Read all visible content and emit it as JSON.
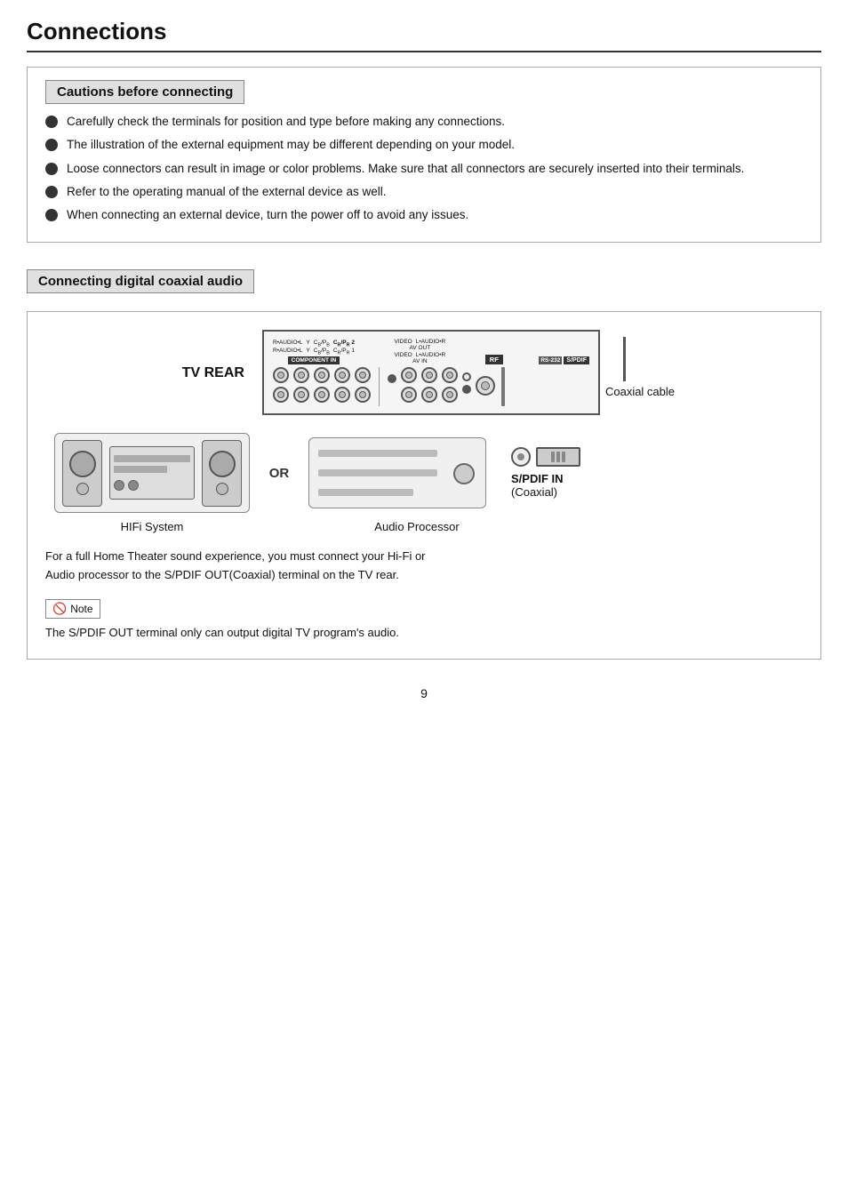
{
  "page": {
    "title": "Connections",
    "page_number": "9"
  },
  "cautions_section": {
    "header": "Cautions before connecting",
    "bullets": [
      "Carefully check the terminals for position and type before making any connections.",
      "The illustration of the external equipment may be different depending on your model.",
      "Loose connectors can result in image or color problems.  Make sure that all connectors are securely inserted into their terminals.",
      "Refer to the operating manual of the external device as well.",
      "When connecting an external device, turn the power off to avoid any issues."
    ]
  },
  "connecting_section": {
    "header": "Connecting digital coaxial audio",
    "tv_rear_label": "TV REAR",
    "or_label": "OR",
    "coaxial_cable_label": "Coaxial cable",
    "spdif_label": "S/PDIF IN",
    "spdif_sub_label": "(Coaxial)",
    "hifi_label": "HIFi  System",
    "processor_label": "Audio  Processor",
    "caption": "For a full Home Theater sound experience, you must connect your Hi-Fi or\nAudio processor to the S/PDIF OUT(Coaxial) terminal on the TV rear.",
    "note_label": "Note",
    "note_text": "The S/PDIF OUT terminal only can output digital TV program's audio.",
    "panel_labels": {
      "component_in": "COMPONENT IN",
      "av_out": "AV OUT",
      "av_in": "AV IN",
      "rf": "RF",
      "rs232": "RS-232",
      "spdif": "S/PDIF"
    }
  }
}
